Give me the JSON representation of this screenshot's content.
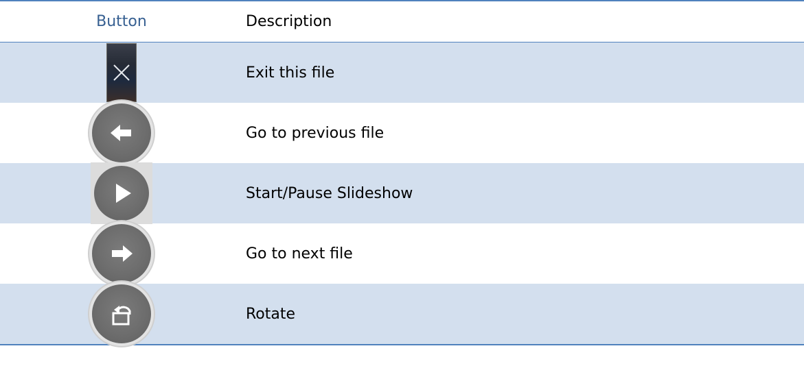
{
  "table": {
    "header": {
      "button_label": "Button",
      "description_label": "Description"
    },
    "rows": [
      {
        "icon": "close-x-icon",
        "description": "Exit this file"
      },
      {
        "icon": "arrow-left-circle-icon",
        "description": "Go to previous file"
      },
      {
        "icon": "play-circle-icon",
        "description": "Start/Pause Slideshow"
      },
      {
        "icon": "arrow-right-circle-icon",
        "description": "Go to next file"
      },
      {
        "icon": "rotate-circle-icon",
        "description": "Rotate"
      }
    ]
  },
  "colors": {
    "rule": "#4f81bd",
    "header_button_text": "#365f91",
    "band_shade": "#d3dfee",
    "icon_gray": "#6d6d6d"
  }
}
